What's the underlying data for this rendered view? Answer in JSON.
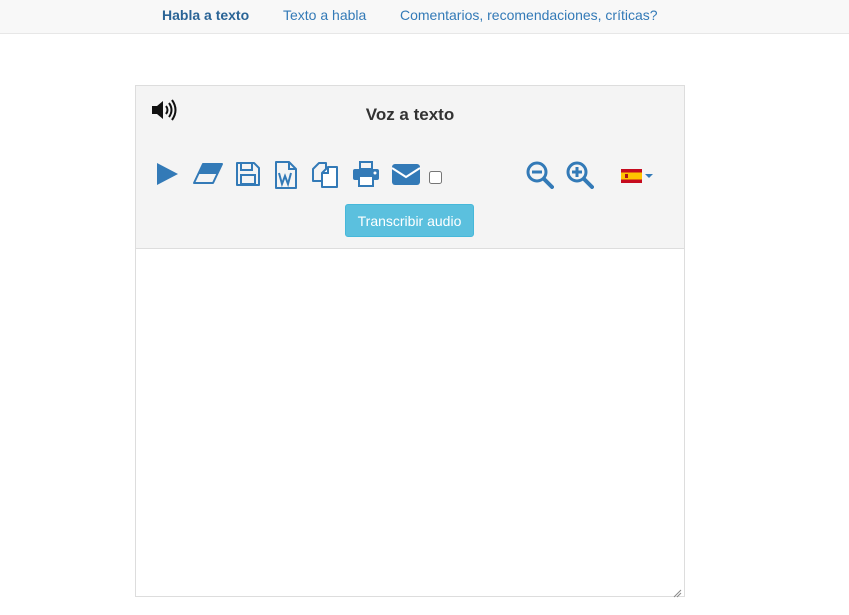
{
  "nav": {
    "items": [
      {
        "label": "Habla a texto",
        "active": true
      },
      {
        "label": "Texto a habla",
        "active": false
      },
      {
        "label": "Comentarios, recomendaciones, críticas?",
        "active": false
      }
    ]
  },
  "panel": {
    "title": "Voz a texto",
    "transcribe_button": "Transcribir audio",
    "textarea_value": "",
    "toolbar_icons": [
      "speaker-icon",
      "play-icon",
      "eraser-icon",
      "save-icon",
      "word-document-icon",
      "copy-icon",
      "print-icon",
      "email-icon",
      "zoom-out-icon",
      "zoom-in-icon",
      "spain-flag-icon"
    ],
    "email_checkbox_checked": false,
    "language": "es"
  },
  "colors": {
    "accent": "#337ab7",
    "button": "#5bc0de",
    "panel_header": "#f4f4f4"
  }
}
